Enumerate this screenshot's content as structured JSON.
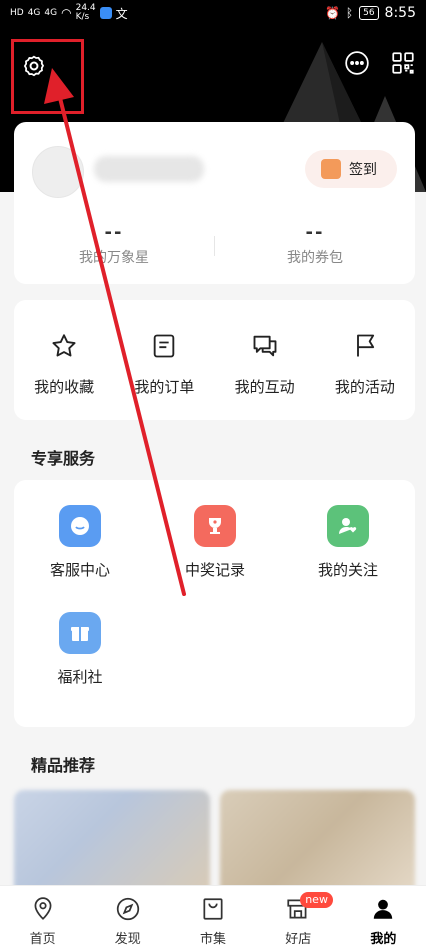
{
  "status_bar": {
    "left_labels": [
      "HD",
      "4G",
      "4G"
    ],
    "speed": "24.4",
    "speed_unit": "K/s",
    "battery": "56",
    "time": "8:55"
  },
  "user_card": {
    "signin_label": "签到",
    "stats": [
      {
        "value": "--",
        "label": "我的万象星"
      },
      {
        "value": "--",
        "label": "我的券包"
      }
    ]
  },
  "quick_actions": [
    {
      "label": "我的收藏",
      "icon": "star-icon"
    },
    {
      "label": "我的订单",
      "icon": "order-icon"
    },
    {
      "label": "我的互动",
      "icon": "chat-icon"
    },
    {
      "label": "我的活动",
      "icon": "flag-icon"
    }
  ],
  "services": {
    "title": "专享服务",
    "items": [
      {
        "label": "客服中心",
        "icon": "customer-service-icon",
        "color": "#5a9cf2"
      },
      {
        "label": "中奖记录",
        "icon": "trophy-icon",
        "color": "#f46a5e"
      },
      {
        "label": "我的关注",
        "icon": "follow-icon",
        "color": "#5cc27a"
      },
      {
        "label": "福利社",
        "icon": "gift-icon",
        "color": "#6aa8f0"
      }
    ]
  },
  "recommend": {
    "title": "精品推荐"
  },
  "tabs": [
    {
      "label": "首页",
      "icon": "home-location-icon"
    },
    {
      "label": "发现",
      "icon": "compass-icon"
    },
    {
      "label": "市集",
      "icon": "shopping-bag-icon"
    },
    {
      "label": "好店",
      "icon": "store-icon",
      "badge": "new"
    },
    {
      "label": "我的",
      "icon": "profile-icon",
      "active": true
    }
  ],
  "colors": {
    "highlight": "#e0202a",
    "header_bg": "#000000"
  }
}
